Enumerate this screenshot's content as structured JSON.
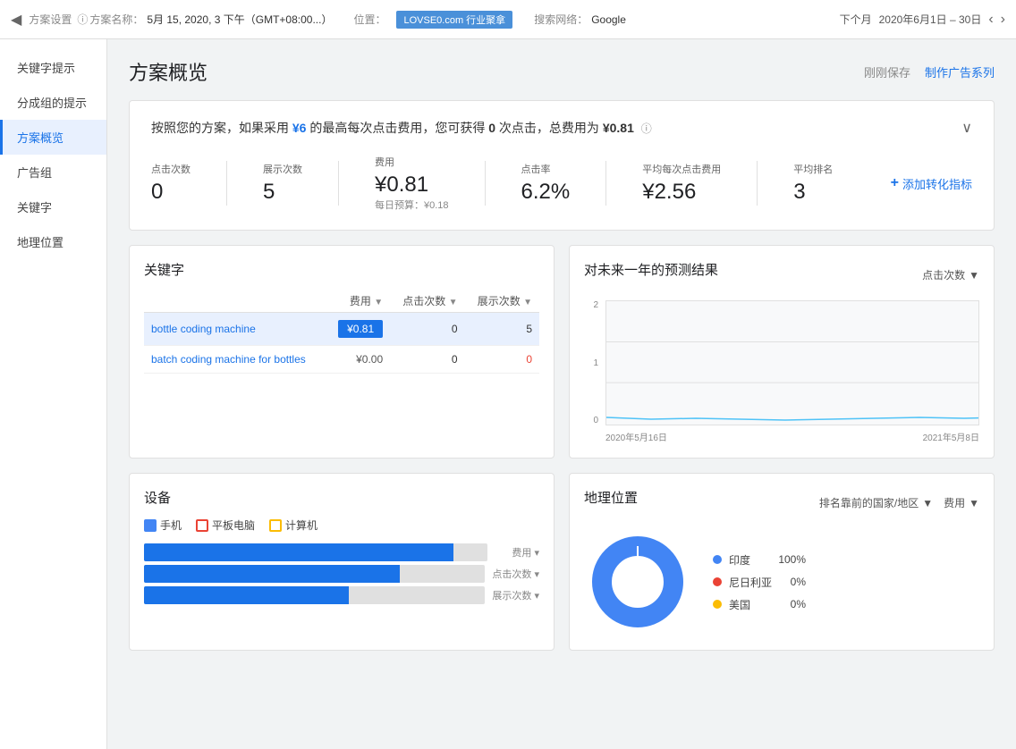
{
  "topbar": {
    "arrow_back": "◀",
    "plan_label": "方案设置",
    "plan_name_label": "方案名称：",
    "plan_name_value": "5月 15, 2020, 3 下午（GMT+08:00...）",
    "location_label": "位置：",
    "watermark": "LOVSE0.com 行业聚拿",
    "search_network_label": "搜索网络：",
    "search_network_value": "Google",
    "next_month_label": "下个月",
    "next_month_value": "2020年6月1日 – 30日",
    "arrow_prev": "‹",
    "arrow_next": "›"
  },
  "sidebar": {
    "items": [
      {
        "label": "关键字提示"
      },
      {
        "label": "分成组的提示"
      },
      {
        "label": "方案概览",
        "active": true
      },
      {
        "label": "广告组"
      },
      {
        "label": "关键字"
      },
      {
        "label": "地理位置"
      }
    ]
  },
  "page": {
    "title": "方案概览",
    "save_label": "刚刚保存",
    "create_btn": "制作广告系列"
  },
  "summary": {
    "description": "按照您的方案，如果采用 ¥6 的最高每次点击费用，您可获得 0 次点击，总费用为 ¥0.81",
    "desc_highlight": "¥6",
    "desc_clicks": "0",
    "desc_total": "¥0.81",
    "stats": [
      {
        "label": "点击次数",
        "value": "0",
        "sub": ""
      },
      {
        "label": "展示次数",
        "value": "5",
        "sub": ""
      },
      {
        "label": "费用",
        "value": "¥0.81",
        "sub": "每日预算：¥0.18"
      },
      {
        "label": "点击率",
        "value": "6.2%",
        "sub": ""
      },
      {
        "label": "平均每次点击费用",
        "value": "¥2.56",
        "sub": ""
      },
      {
        "label": "平均排名",
        "value": "3",
        "sub": ""
      }
    ],
    "add_conversion": "添加转化指标"
  },
  "keywords": {
    "title": "关键字",
    "col_cost": "费用",
    "col_clicks": "点击次数",
    "col_impressions": "展示次数",
    "rows": [
      {
        "name": "bottle coding machine",
        "cost": "¥0.81",
        "clicks": "0",
        "impressions": "5",
        "highlighted": true
      },
      {
        "name": "batch coding machine for bottles",
        "cost": "¥0.00",
        "clicks": "0",
        "impressions": "0",
        "highlighted": false
      }
    ]
  },
  "forecast": {
    "title": "对未来一年的预测结果",
    "dropdown": "点击次数",
    "y_labels": [
      "2",
      "1",
      "0"
    ],
    "x_labels": [
      "2020年5月16日",
      "2021年5月8日"
    ]
  },
  "devices": {
    "title": "设备",
    "legend": [
      {
        "label": "手机",
        "color": "#4285f4",
        "border": "#4285f4"
      },
      {
        "label": "平板电脑",
        "color": "#fff",
        "border": "#ea4335"
      },
      {
        "label": "计算机",
        "color": "#fff",
        "border": "#fbbc04"
      }
    ],
    "bars": [
      {
        "label": "费用 ▾",
        "fill": 90
      },
      {
        "label": "点击次数 ▾",
        "fill": 75
      },
      {
        "label": "展示次数 ▾",
        "fill": 60
      }
    ]
  },
  "geo": {
    "title": "地理位置",
    "filter_label": "排名靠前的国家/地区",
    "cost_label": "费用",
    "legend": [
      {
        "label": "印度",
        "color": "#4285f4",
        "pct": "100%"
      },
      {
        "label": "尼日利亚",
        "color": "#ea4335",
        "pct": "0%"
      },
      {
        "label": "美国",
        "color": "#fbbc04",
        "pct": "0%"
      }
    ]
  }
}
